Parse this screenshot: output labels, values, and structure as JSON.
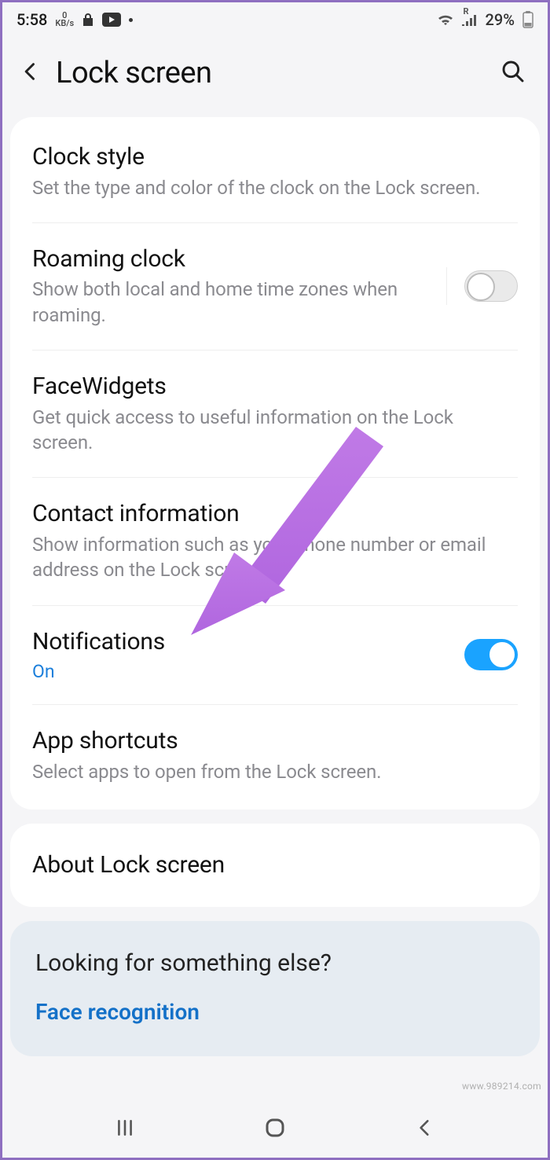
{
  "status_bar": {
    "time": "5:58",
    "data_rate_value": "0",
    "data_rate_unit": "KB/s",
    "battery_pct": "29%",
    "signal_label": "R"
  },
  "header": {
    "title": "Lock screen"
  },
  "settings": {
    "clock_style": {
      "title": "Clock style",
      "desc": "Set the type and color of the clock on the Lock screen."
    },
    "roaming_clock": {
      "title": "Roaming clock",
      "desc": "Show both local and home time zones when roaming.",
      "enabled": false
    },
    "face_widgets": {
      "title": "FaceWidgets",
      "desc": "Get quick access to useful information on the Lock screen."
    },
    "contact_info": {
      "title": "Contact information",
      "desc": "Show information such as your phone number or email address on the Lock screen."
    },
    "notifications": {
      "title": "Notifications",
      "status": "On",
      "enabled": true
    },
    "app_shortcuts": {
      "title": "App shortcuts",
      "desc": "Select apps to open from the Lock screen."
    },
    "about": {
      "title": "About Lock screen"
    }
  },
  "suggestion": {
    "heading": "Looking for something else?",
    "link": "Face recognition"
  },
  "watermark": "www.989214.com"
}
